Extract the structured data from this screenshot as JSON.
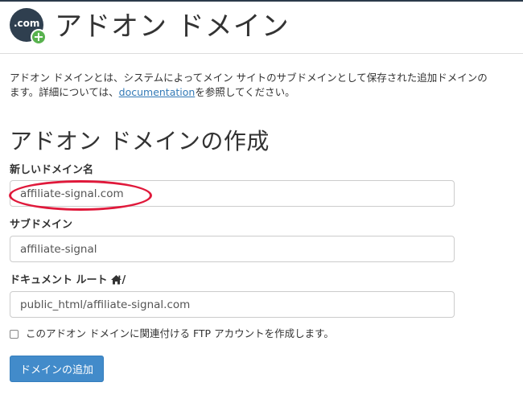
{
  "header": {
    "title": "アドオン ドメイン",
    "icon": "addon-domain-icon",
    "icon_text": ".com",
    "icon_badge": "+"
  },
  "description": {
    "text_before_link": "アドオン ドメインとは、システムによってメイン サイトのサブドメインとして保存された追加ドメインの\nます。詳細については、",
    "link_text": "documentation",
    "text_after_link": "を参照してください。"
  },
  "form": {
    "section_title": "アドオン ドメインの作成",
    "new_domain": {
      "label": "新しいドメイン名",
      "value": "affiliate-signal.com"
    },
    "subdomain": {
      "label": "サブドメイン",
      "value": "affiliate-signal"
    },
    "document_root": {
      "label_before_icon": "ドキュメント ルート",
      "icon": "home-icon",
      "label_after_icon": "/",
      "value": "public_html/affiliate-signal.com"
    },
    "ftp_checkbox": {
      "checked": false,
      "label": "このアドオン ドメインに関連付ける FTP アカウントを作成します。"
    },
    "submit_label": "ドメインの追加"
  },
  "colors": {
    "accent": "#428bca",
    "link": "#337ab7",
    "highlight": "#e0193b",
    "icon_bg": "#2f3f4f",
    "icon_badge": "#58b24e"
  }
}
